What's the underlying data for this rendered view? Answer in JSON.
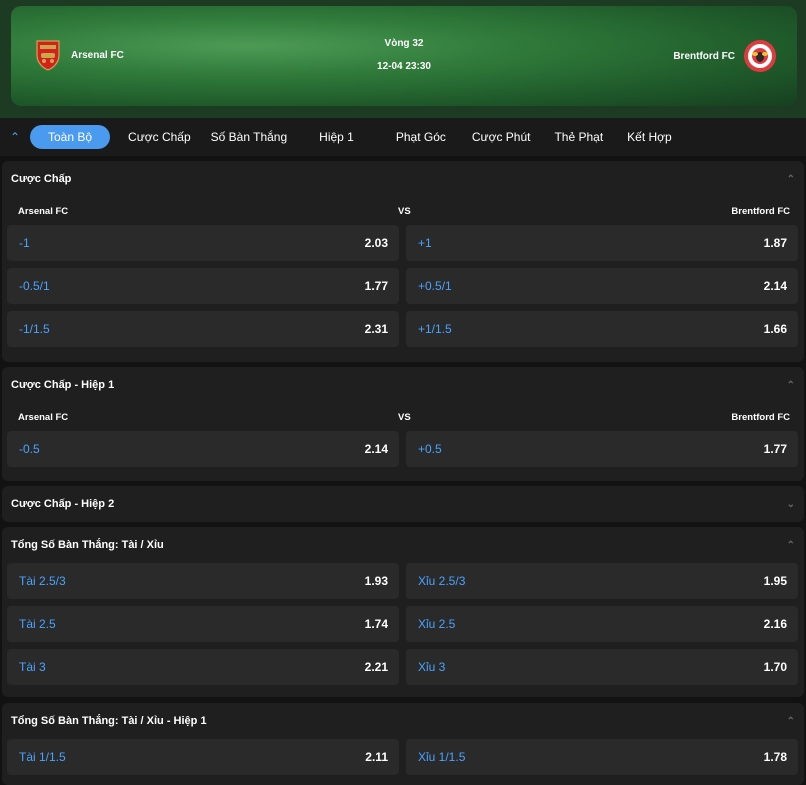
{
  "match": {
    "round": "Vòng 32",
    "datetime": "12-04 23:30",
    "home": "Arsenal FC",
    "away": "Brentford FC"
  },
  "tabs": [
    "Toàn Bộ",
    "Cược Chấp",
    "Số Bàn Thắng",
    "Hiệp 1",
    "Phạt Góc",
    "Cược Phút",
    "Thẻ Phạt",
    "Kết Hợp"
  ],
  "sections": {
    "handicap": {
      "title": "Cược Chấp",
      "home": "Arsenal FC",
      "vs": "VS",
      "away": "Brentford FC",
      "rows": [
        {
          "l": "-1",
          "lv": "2.03",
          "r": "+1",
          "rv": "1.87"
        },
        {
          "l": "-0.5/1",
          "lv": "1.77",
          "r": "+0.5/1",
          "rv": "2.14"
        },
        {
          "l": "-1/1.5",
          "lv": "2.31",
          "r": "+1/1.5",
          "rv": "1.66"
        }
      ]
    },
    "handicap_h1": {
      "title": "Cược Chấp - Hiệp 1",
      "home": "Arsenal FC",
      "vs": "VS",
      "away": "Brentford FC",
      "rows": [
        {
          "l": "-0.5",
          "lv": "2.14",
          "r": "+0.5",
          "rv": "1.77"
        }
      ]
    },
    "handicap_h2": {
      "title": "Cược Chấp - Hiệp 2"
    },
    "total": {
      "title": "Tổng Số Bàn Thắng: Tài / Xỉu",
      "rows": [
        {
          "l": "Tài 2.5/3",
          "lv": "1.93",
          "r": "Xỉu 2.5/3",
          "rv": "1.95"
        },
        {
          "l": "Tài 2.5",
          "lv": "1.74",
          "r": "Xỉu 2.5",
          "rv": "2.16"
        },
        {
          "l": "Tài 3",
          "lv": "2.21",
          "r": "Xỉu 3",
          "rv": "1.70"
        }
      ]
    },
    "total_h1": {
      "title": "Tổng Số Bàn Thắng: Tài / Xỉu - Hiệp 1",
      "rows": [
        {
          "l": "Tài 1/1.5",
          "lv": "2.11",
          "r": "Xỉu 1/1.5",
          "rv": "1.78"
        }
      ]
    }
  },
  "colors": {
    "accent": "#4a9bf0",
    "odds_label": "#4aa3ff",
    "panel": "#1f1f1f",
    "cell": "#2a2a2a"
  },
  "icons": {
    "collapse": "double-chevron-up-icon",
    "section_toggle": "chevron-icon"
  }
}
